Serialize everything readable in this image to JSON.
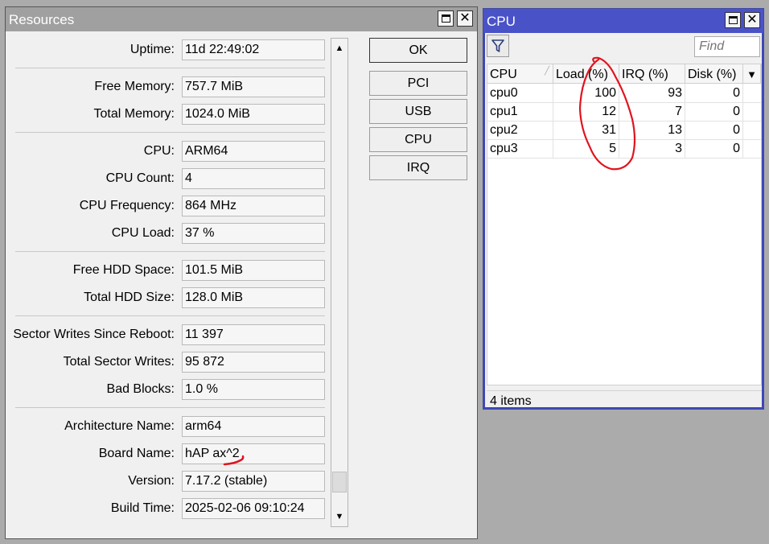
{
  "resources": {
    "title": "Resources",
    "groups": [
      [
        {
          "label": "Uptime:",
          "value": "11d 22:49:02"
        }
      ],
      [
        {
          "label": "Free Memory:",
          "value": "757.7 MiB"
        },
        {
          "label": "Total Memory:",
          "value": "1024.0 MiB"
        }
      ],
      [
        {
          "label": "CPU:",
          "value": "ARM64"
        },
        {
          "label": "CPU Count:",
          "value": "4"
        },
        {
          "label": "CPU Frequency:",
          "value": "864 MHz"
        },
        {
          "label": "CPU Load:",
          "value": "37 %"
        }
      ],
      [
        {
          "label": "Free HDD Space:",
          "value": "101.5 MiB"
        },
        {
          "label": "Total HDD Size:",
          "value": "128.0 MiB"
        }
      ],
      [
        {
          "label": "Sector Writes Since Reboot:",
          "value": "11 397"
        },
        {
          "label": "Total Sector Writes:",
          "value": "95 872"
        },
        {
          "label": "Bad Blocks:",
          "value": "1.0 %"
        }
      ],
      [
        {
          "label": "Architecture Name:",
          "value": "arm64"
        },
        {
          "label": "Board Name:",
          "value": "hAP ax^2"
        },
        {
          "label": "Version:",
          "value": "7.17.2 (stable)"
        },
        {
          "label": "Build Time:",
          "value": "2025-02-06 09:10:24"
        }
      ]
    ],
    "buttons": [
      "OK",
      "PCI",
      "USB",
      "CPU",
      "IRQ"
    ],
    "scroll_position": 0.96
  },
  "cpu_window": {
    "title": "CPU",
    "find_placeholder": "Find",
    "columns": [
      "CPU",
      "Load (%)",
      "IRQ (%)",
      "Disk (%)"
    ],
    "rows": [
      {
        "cpu": "cpu0",
        "load": "100",
        "irq": "93",
        "disk": "0"
      },
      {
        "cpu": "cpu1",
        "load": "12",
        "irq": "7",
        "disk": "0"
      },
      {
        "cpu": "cpu2",
        "load": "31",
        "irq": "13",
        "disk": "0"
      },
      {
        "cpu": "cpu3",
        "load": "5",
        "irq": "3",
        "disk": "0"
      }
    ],
    "footer": "4 items"
  },
  "colors": {
    "annotation": "#e0141e",
    "cpu_titlebar": "#4a52c8",
    "resources_titlebar": "#a0a0a0"
  }
}
